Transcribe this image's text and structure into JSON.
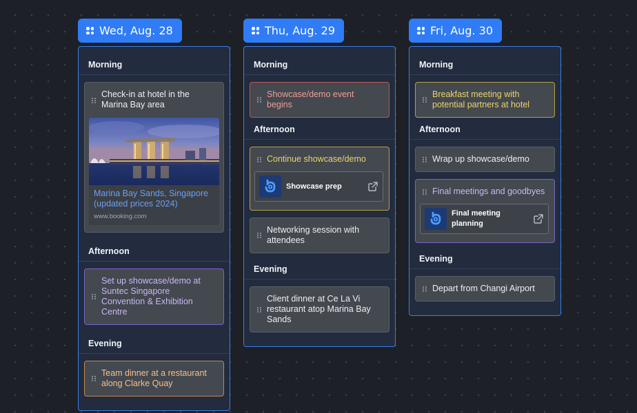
{
  "days": [
    {
      "date": "Wed, Aug. 28",
      "sections": {
        "morning": "Morning",
        "afternoon": "Afternoon",
        "evening": "Evening"
      },
      "cards": {
        "checkin": "Check-in at hotel in the Marina Bay area",
        "link_title": "Marina Bay Sands, Singapore (updated prices 2024)",
        "link_domain": "www.booking.com",
        "setup": "Set up showcase/demo at Suntec Singapore Convention & Exhibition Centre",
        "dinner": "Team dinner at a restaurant along Clarke Quay"
      }
    },
    {
      "date": "Thu, Aug. 29",
      "sections": {
        "morning": "Morning",
        "afternoon": "Afternoon",
        "evening": "Evening"
      },
      "cards": {
        "event_begins": "Showcase/demo event begins",
        "continue": "Continue showcase/demo",
        "embed_label": "Showcase prep",
        "networking": "Networking session with attendees",
        "client_dinner": "Client dinner at Ce La Vi restaurant atop Marina Bay Sands"
      }
    },
    {
      "date": "Fri, Aug. 30",
      "sections": {
        "morning": "Morning",
        "afternoon": "Afternoon",
        "evening": "Evening"
      },
      "cards": {
        "breakfast": "Breakfast meeting with potential partners at hotel",
        "wrapup": "Wrap up showcase/demo",
        "final_meetings": "Final meetings and goodbyes",
        "embed_label": "Final meeting planning",
        "depart": "Depart from Changi Airport"
      }
    }
  ],
  "colors": {
    "accent": "#2f7cf6",
    "panel_border": "#3b7ee6",
    "orange": "#f3c08e",
    "purple": "#c7b8f5",
    "red": "#f29c97",
    "yellow": "#ecd46a",
    "link": "#6d9ff0"
  },
  "icons": {
    "date_tab": "drag-grid-icon",
    "card_handle": "drag-handle-icon",
    "embed_app": "app-logo-icon",
    "open_external": "external-link-icon"
  }
}
